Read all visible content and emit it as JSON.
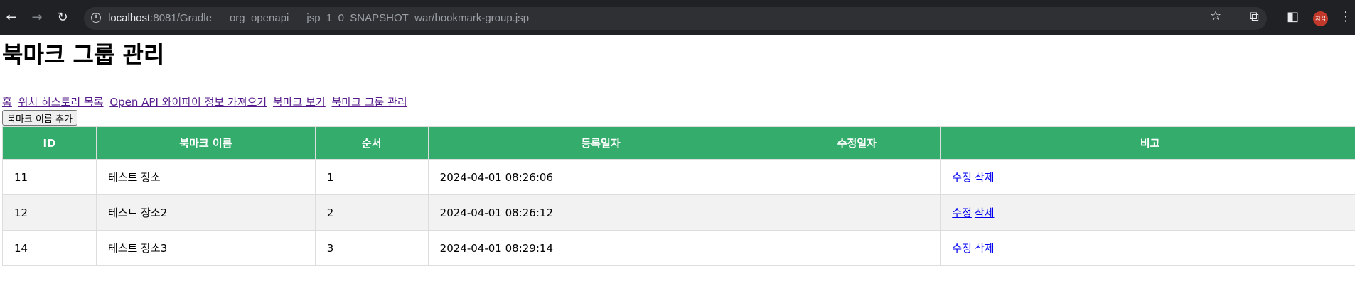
{
  "browser": {
    "url_host": "localhost",
    "url_path": ":8081/Gradle___org_openapi___jsp_1_0_SNAPSHOT_war/bookmark-group.jsp",
    "profile_label": "지섭"
  },
  "page": {
    "title": "북마크 그룹 관리",
    "nav_links": [
      "홈",
      "위치 히스토리 목록",
      "Open API 와이파이 정보 가져오기",
      "북마크 보기",
      "북마크 그룹 관리"
    ],
    "add_button_label": "북마크 이름 추가"
  },
  "table": {
    "headers": [
      "ID",
      "북마크 이름",
      "순서",
      "등록일자",
      "수정일자",
      "비고"
    ],
    "rows": [
      {
        "id": "11",
        "name": "테스트 장소",
        "order": "1",
        "created": "2024-04-01 08:26:06",
        "modified": "",
        "edit": "수정",
        "delete": "삭제"
      },
      {
        "id": "12",
        "name": "테스트 장소2",
        "order": "2",
        "created": "2024-04-01 08:26:12",
        "modified": "",
        "edit": "수정",
        "delete": "삭제"
      },
      {
        "id": "14",
        "name": "테스트 장소3",
        "order": "3",
        "created": "2024-04-01 08:29:14",
        "modified": "",
        "edit": "수정",
        "delete": "삭제"
      }
    ]
  },
  "colors": {
    "header_bg": "#34ac6c",
    "row_alt_bg": "#f2f2f2",
    "visited_link": "#551a8b",
    "link": "#0000ee"
  }
}
